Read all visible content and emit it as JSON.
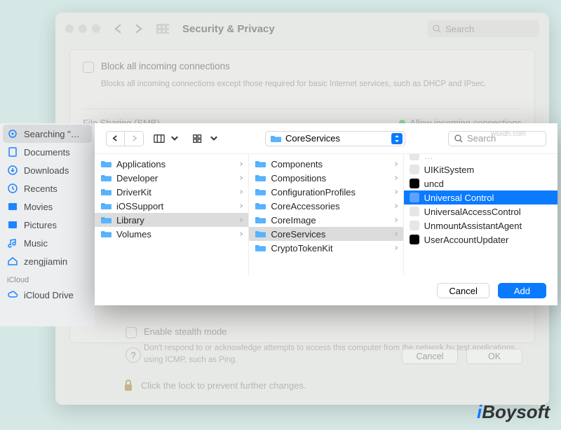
{
  "bg": {
    "title": "Security & Privacy",
    "search_placeholder": "Search",
    "block_title": "Block all incoming connections",
    "block_desc": "Blocks all incoming connections except those required for basic Internet services, such as DHCP and IPsec.",
    "file_sharing": "File Sharing (SMB)",
    "allow": "Allow incoming connections",
    "stealth_title": "Enable stealth mode",
    "stealth_desc": "Don't respond to or acknowledge attempts to access this computer from the network by test applications using ICMP, such as Ping.",
    "cancel": "Cancel",
    "ok": "OK",
    "lock_text": "Click the lock to prevent further changes."
  },
  "sidebar": {
    "items": [
      {
        "icon": "gear",
        "label": "Searching \"…"
      },
      {
        "icon": "doc",
        "label": "Documents"
      },
      {
        "icon": "download",
        "label": "Downloads"
      },
      {
        "icon": "clock",
        "label": "Recents"
      },
      {
        "icon": "movie",
        "label": "Movies"
      },
      {
        "icon": "picture",
        "label": "Pictures"
      },
      {
        "icon": "music",
        "label": "Music"
      },
      {
        "icon": "home",
        "label": "zengjiamin"
      }
    ],
    "section": "iCloud",
    "cloud_label": "iCloud Drive"
  },
  "sheet": {
    "path_label": "CoreServices",
    "search_placeholder": "Search",
    "col1": [
      "Applications",
      "Developer",
      "DriverKit",
      "iOSSupport",
      "Library",
      "Volumes"
    ],
    "col1_sel": 4,
    "col2": [
      "Components",
      "Compositions",
      "ConfigurationProfiles",
      "CoreAccessories",
      "CoreImage",
      "CoreServices",
      "CryptoTokenKit"
    ],
    "col2_sel": 5,
    "col3": [
      {
        "label": "UIKitSystem",
        "k": "blank"
      },
      {
        "label": "uncd",
        "k": "exec"
      },
      {
        "label": "Universal Control",
        "k": "app",
        "hl": true
      },
      {
        "label": "UniversalAccessControl",
        "k": "blank"
      },
      {
        "label": "UnmountAssistantAgent",
        "k": "blank"
      },
      {
        "label": "UserAccountUpdater",
        "k": "exec"
      }
    ],
    "col3_top_partial": "",
    "cancel": "Cancel",
    "add": "Add"
  },
  "watermark": {
    "brand_pre": "i",
    "brand": "Boysoft",
    "url": "wsxdn.com"
  }
}
